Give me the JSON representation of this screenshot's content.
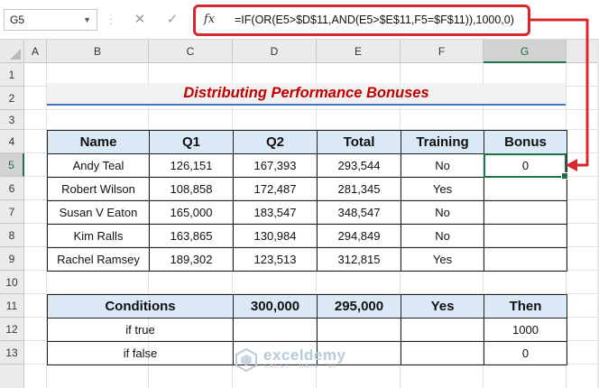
{
  "formula_bar": {
    "name_box": "G5",
    "cancel_symbol": "✕",
    "enter_symbol": "✓",
    "fx_label": "fx",
    "formula": "=IF(OR(E5>$D$11,AND(E5>$E$11,F5=$F$11)),1000,0)"
  },
  "columns": [
    "A",
    "B",
    "C",
    "D",
    "E",
    "F",
    "G"
  ],
  "rows": [
    "1",
    "2",
    "3",
    "4",
    "5",
    "6",
    "7",
    "8",
    "9",
    "10",
    "11",
    "12",
    "13"
  ],
  "selected_cell": {
    "column": "G",
    "row": "5"
  },
  "title": "Distributing Performance Bonuses",
  "bonus_table": {
    "headers": [
      "Name",
      "Q1",
      "Q2",
      "Total",
      "Training",
      "Bonus"
    ],
    "rows": [
      [
        "Andy Teal",
        "126,151",
        "167,393",
        "293,544",
        "No",
        "0"
      ],
      [
        "Robert Wilson",
        "108,858",
        "172,487",
        "281,345",
        "Yes",
        ""
      ],
      [
        "Susan V Eaton",
        "165,000",
        "183,547",
        "348,547",
        "No",
        ""
      ],
      [
        "Kim Ralls",
        "163,865",
        "130,984",
        "294,849",
        "No",
        ""
      ],
      [
        "Rachel Ramsey",
        "189,302",
        "123,513",
        "312,815",
        "Yes",
        ""
      ]
    ]
  },
  "conditions_table": {
    "headers": [
      "Conditions",
      "300,000",
      "295,000",
      "Yes",
      "Then"
    ],
    "rows": [
      [
        "if true",
        "",
        "",
        "",
        "1000"
      ],
      [
        "if false",
        "",
        "",
        "",
        "0"
      ]
    ]
  },
  "watermark": {
    "name": "exceldemy",
    "tagline": "EXCEL · DATA · BI"
  },
  "colors": {
    "accent_green": "#217346",
    "highlight_red": "#d9282b",
    "title_red": "#c00000",
    "header_fill": "#dbe8f6",
    "title_underline": "#4472c4"
  }
}
